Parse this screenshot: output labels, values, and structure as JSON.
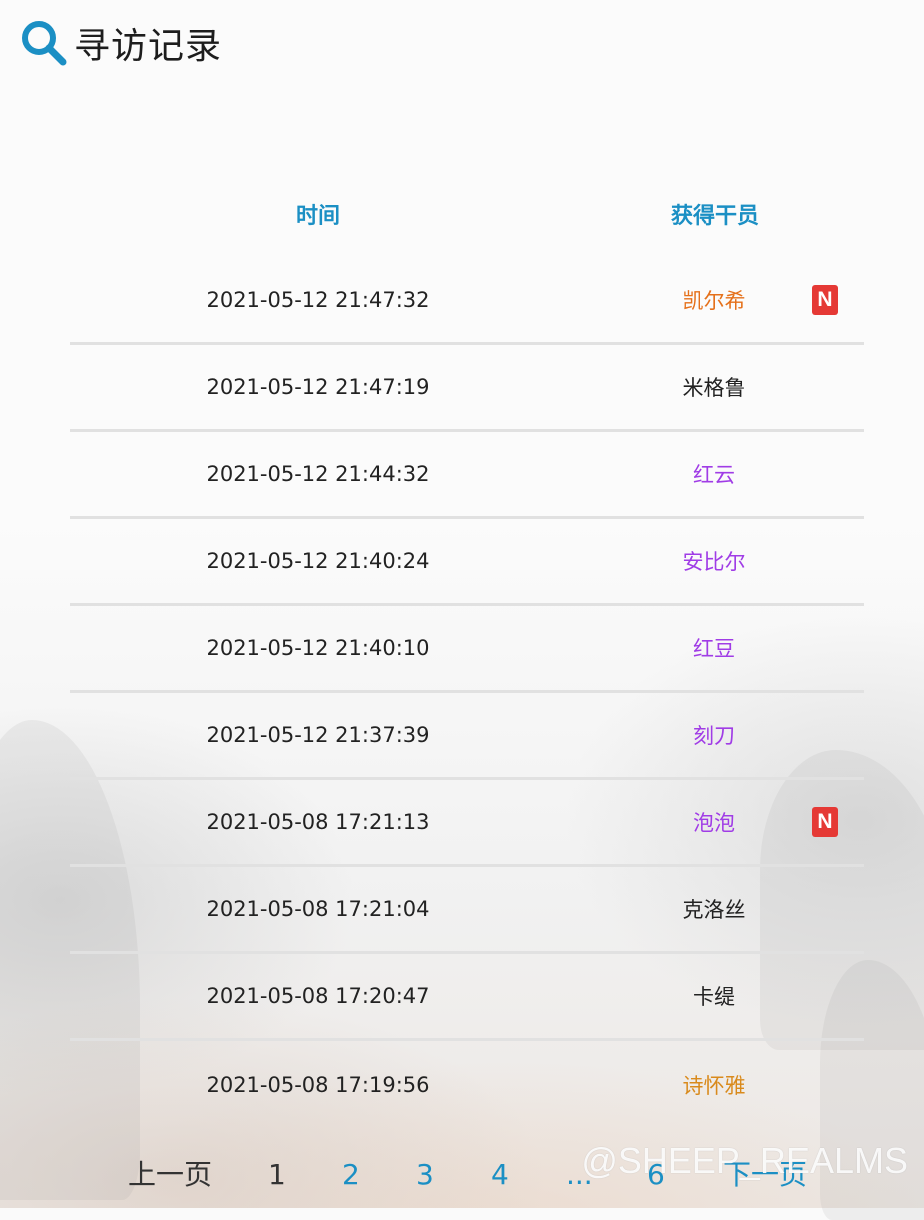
{
  "header": {
    "title": "寻访记录"
  },
  "table": {
    "col_time": "时间",
    "col_operator": "获得干员",
    "rows": [
      {
        "time": "2021-05-12 21:47:32",
        "operator": "凯尔希",
        "color": "#e5701a",
        "new": true
      },
      {
        "time": "2021-05-12 21:47:19",
        "operator": "米格鲁",
        "color": "#222222",
        "new": false
      },
      {
        "time": "2021-05-12 21:44:32",
        "operator": "红云",
        "color": "#a03ce6",
        "new": false
      },
      {
        "time": "2021-05-12 21:40:24",
        "operator": "安比尔",
        "color": "#a03ce6",
        "new": false
      },
      {
        "time": "2021-05-12 21:40:10",
        "operator": "红豆",
        "color": "#a03ce6",
        "new": false
      },
      {
        "time": "2021-05-12 21:37:39",
        "operator": "刻刀",
        "color": "#a03ce6",
        "new": false
      },
      {
        "time": "2021-05-08 17:21:13",
        "operator": "泡泡",
        "color": "#a03ce6",
        "new": true
      },
      {
        "time": "2021-05-08 17:21:04",
        "operator": "克洛丝",
        "color": "#222222",
        "new": false
      },
      {
        "time": "2021-05-08 17:20:47",
        "operator": "卡缇",
        "color": "#222222",
        "new": false
      },
      {
        "time": "2021-05-08 17:19:56",
        "operator": "诗怀雅",
        "color": "#d98a1c",
        "new": false
      }
    ],
    "new_badge": "N"
  },
  "pagination": {
    "prev": "上一页",
    "pages": [
      "1",
      "2",
      "3",
      "4",
      "...",
      "6"
    ],
    "current": "1",
    "next": "下一页",
    "link_color": "#1b8fc4",
    "current_color": "#333333"
  },
  "watermark": "@SHEEP_REALMS"
}
